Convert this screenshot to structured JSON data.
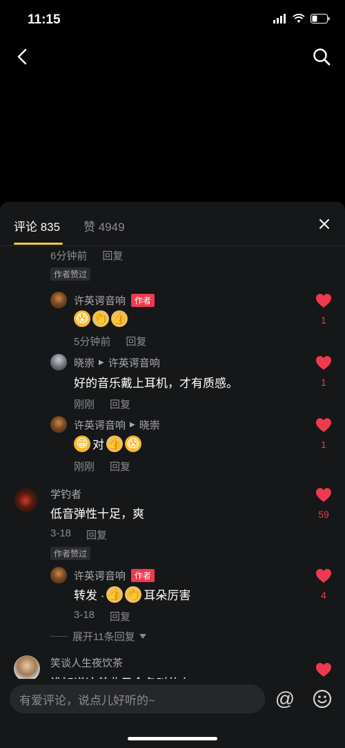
{
  "status": {
    "time": "11:15"
  },
  "tabs": {
    "comments_label": "评论 835",
    "likes_label": "赞 4949"
  },
  "thread_head": {
    "time": "6分钟前",
    "reply": "回复",
    "author_liked": "作者赞过"
  },
  "replies": [
    {
      "name": "许英谔音响",
      "badge": "作者",
      "text": "",
      "emojis": [
        "😱",
        "👏",
        "👍"
      ],
      "time": "5分钟前",
      "reply": "回复",
      "likes": "1"
    },
    {
      "name": "晓崇",
      "target": "许英谔音响",
      "text": "好的音乐戴上耳机，才有质感。",
      "time": "刚刚",
      "reply": "回复",
      "likes": "1"
    },
    {
      "name": "许英谔音响",
      "target": "晓崇",
      "text_after_first": "对",
      "time": "刚刚",
      "reply": "回复",
      "likes": "1"
    }
  ],
  "comment_main": {
    "name": "学钓者",
    "text": "低音弹性十足，爽",
    "time": "3-18",
    "reply": "回复",
    "author_liked": "作者赞过",
    "likes": "59"
  },
  "comment_main_reply": {
    "name": "许英谔音响",
    "badge": "作者",
    "text_prefix": "转发 ·",
    "text_suffix": "耳朵厉害",
    "time": "3-18",
    "reply": "回复",
    "likes": "4"
  },
  "expand": {
    "label": "展开11条回复"
  },
  "comment_last": {
    "name": "笑谈人生夜饮茶",
    "text": "谁知道这首曲子全名叫什么"
  },
  "input": {
    "placeholder": "有爱评论，说点儿好听的~",
    "at_symbol": "@"
  },
  "colors": {
    "accent": "#f7c843",
    "heart": "#ee3a4f",
    "panel": "#161718"
  }
}
